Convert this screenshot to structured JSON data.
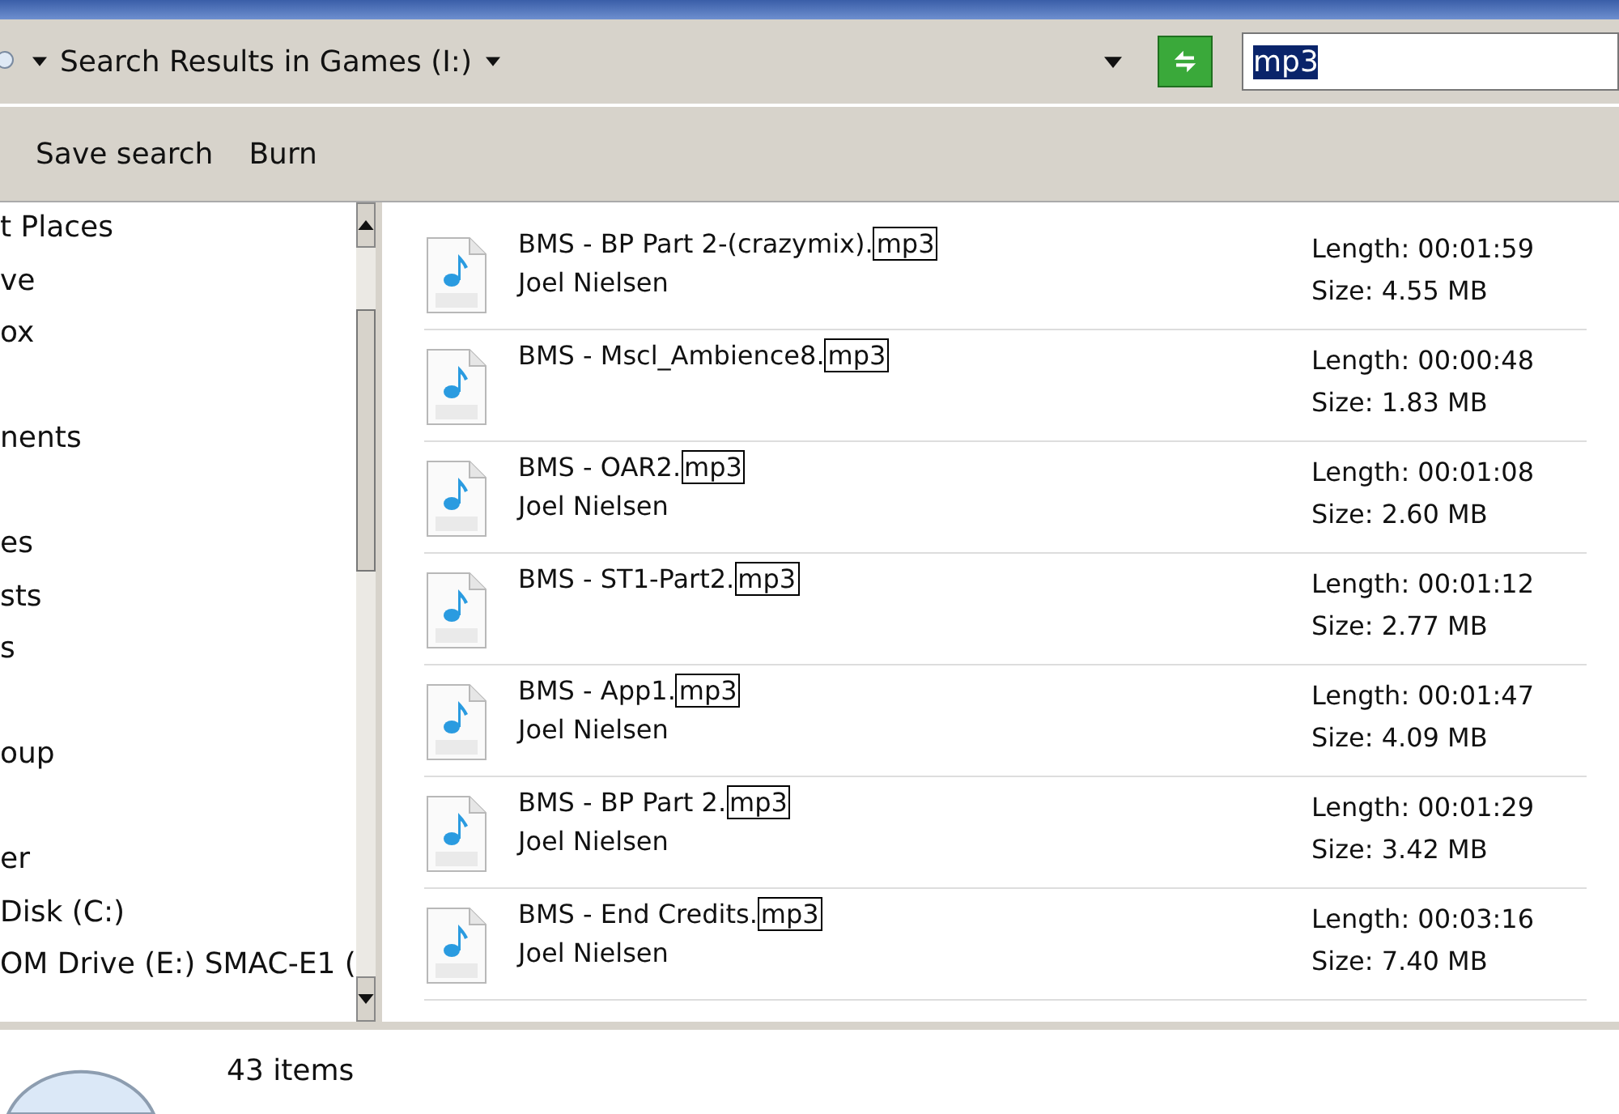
{
  "address_bar": {
    "location": "Search Results in Games (I:)"
  },
  "search": {
    "value": "mp3",
    "selected": true
  },
  "toolbar": [
    "Save search",
    "Burn"
  ],
  "sidebar": {
    "items": [
      {
        "label": "t Places"
      },
      {
        "label": "ve"
      },
      {
        "label": "ox"
      },
      {
        "label": "nents"
      },
      {
        "label": "es"
      },
      {
        "label": "sts"
      },
      {
        "label": "s"
      },
      {
        "label": "oup"
      },
      {
        "label": "er"
      },
      {
        "label": "Disk (C:)"
      },
      {
        "label": "OM Drive (E:) SMAC-E1 ("
      }
    ]
  },
  "files": [
    {
      "name": "BMS - BP Part 2-(crazymix).",
      "match": "mp3",
      "artist": "Joel Nielsen",
      "length": "Length: 00:01:59",
      "size": "Size: 4.55 MB"
    },
    {
      "name": "BMS - Mscl_Ambience8.",
      "match": "mp3",
      "length": "Length: 00:00:48",
      "size": "Size: 1.83 MB"
    },
    {
      "name": "BMS - OAR2.",
      "match": "mp3",
      "artist": "Joel Nielsen",
      "length": "Length: 00:01:08",
      "size": "Size: 2.60 MB"
    },
    {
      "name": "BMS - ST1-Part2.",
      "match": "mp3",
      "length": "Length: 00:01:12",
      "size": "Size: 2.77 MB"
    },
    {
      "name": "BMS - App1.",
      "match": "mp3",
      "artist": "Joel Nielsen",
      "length": "Length: 00:01:47",
      "size": "Size: 4.09 MB"
    },
    {
      "name": "BMS - BP Part 2.",
      "match": "mp3",
      "artist": "Joel Nielsen",
      "length": "Length: 00:01:29",
      "size": "Size: 3.42 MB"
    },
    {
      "name": "BMS - End Credits.",
      "match": "mp3",
      "artist": "Joel Nielsen",
      "length": "Length: 00:03:16",
      "size": "Size: 7.40 MB"
    }
  ],
  "status_bar": {
    "count": "43 items"
  }
}
